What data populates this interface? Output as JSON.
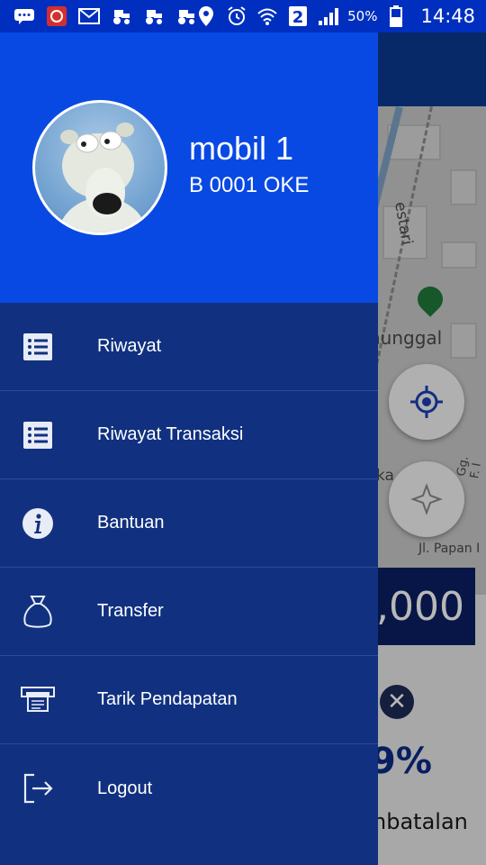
{
  "status_bar": {
    "battery_percent": "50%",
    "sim_slot": "2",
    "time": "14:48"
  },
  "user": {
    "name": "mobil 1",
    "plate": "B 0001 OKE"
  },
  "menu": {
    "items": [
      {
        "label": "Riwayat",
        "icon": "list-icon"
      },
      {
        "label": "Riwayat Transaksi",
        "icon": "list-icon"
      },
      {
        "label": "Bantuan",
        "icon": "info-icon"
      },
      {
        "label": "Transfer",
        "icon": "money-bag-icon"
      },
      {
        "label": "Tarik Pendapatan",
        "icon": "atm-icon"
      },
      {
        "label": "Logout",
        "icon": "logout-icon"
      }
    ]
  },
  "background": {
    "map_labels": [
      "estari",
      "nunggal",
      "Gg. F. I",
      "ka",
      "Jl. Papan I"
    ],
    "balance_partial": ",000",
    "percent_partial": "9%",
    "cancel_partial": "nbatalan"
  },
  "colors": {
    "status_bar": "#002fc0",
    "drawer_header": "#0949e3",
    "drawer_body": "#113180",
    "divider": "#2e4a9a"
  }
}
